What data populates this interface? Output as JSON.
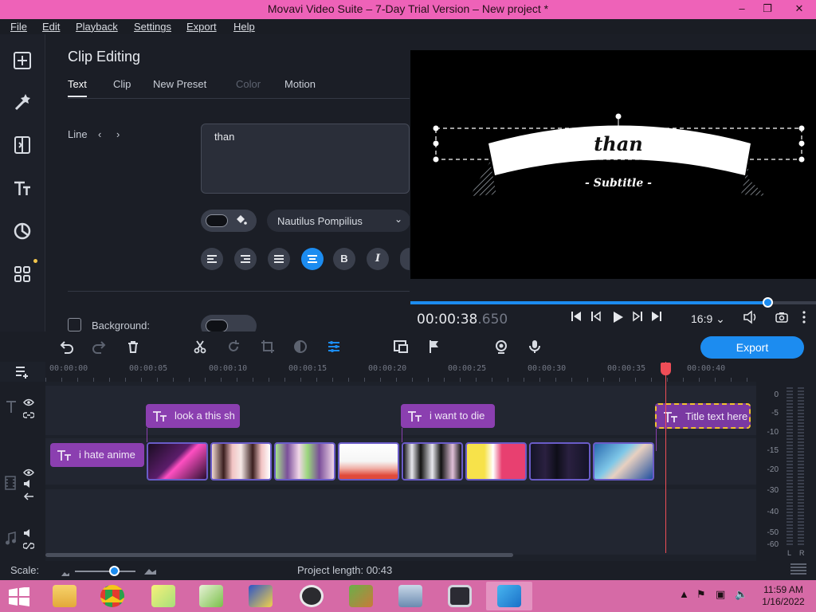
{
  "window": {
    "title": "Movavi Video Suite – 7-Day Trial Version – New project *",
    "minimize": "–",
    "restore": "❐",
    "close": "✕"
  },
  "menu": [
    "File",
    "Edit",
    "Playback",
    "Settings",
    "Export",
    "Help"
  ],
  "rail": {
    "icons": [
      "import-icon",
      "magic-wand-icon",
      "transitions-icon",
      "titles-icon",
      "stickers-icon",
      "more-tools-icon"
    ],
    "badge_color": "#f3c64c"
  },
  "clip_editing": {
    "title": "Clip Editing",
    "tabs": [
      {
        "label": "Text",
        "active": true
      },
      {
        "label": "Clip"
      },
      {
        "label": "New Preset"
      },
      {
        "label": "Color",
        "disabled": true
      },
      {
        "label": "Motion"
      }
    ],
    "line_label": "Line",
    "prev_arrow": "‹",
    "next_arrow": "›",
    "text_value": "than",
    "font": "Nautilus Pompilius",
    "font_chevron": "⌄",
    "format_buttons": [
      "align-left",
      "align-right",
      "justify",
      "align-center",
      "B",
      "I"
    ],
    "background_label": "Background:"
  },
  "preview": {
    "title_text": "than",
    "subtitle_text": "- Subtitle -",
    "timecode_main": "00:00:38",
    "timecode_ms": ".650",
    "aspect": "16:9",
    "aspect_chevron": "⌄",
    "progress": 0.88
  },
  "toolbar": {
    "export_label": "Export",
    "accent": "#1c8cf0"
  },
  "timeline": {
    "ticks": [
      "00:00:00",
      "00:00:05",
      "00:00:10",
      "00:00:15",
      "00:00:20",
      "00:00:25",
      "00:00:30",
      "00:00:35",
      "00:00:40"
    ],
    "title_clips": [
      {
        "label": "look a this sh"
      },
      {
        "label": "i want to die"
      },
      {
        "label": "Title text here",
        "selected": true
      }
    ],
    "video_title_clip": {
      "label": "i hate anime"
    },
    "meter_labels": [
      "0",
      "-5",
      "-10",
      "-15",
      "-20",
      "-30",
      "-40",
      "-50",
      "-60"
    ],
    "meter_channels": [
      "L",
      "R"
    ]
  },
  "status": {
    "scale_label": "Scale:",
    "project_length": "Project length:  00:43"
  },
  "taskbar": {
    "time": "11:59 AM",
    "date": "1/16/2022",
    "color": "#d66aa6"
  }
}
